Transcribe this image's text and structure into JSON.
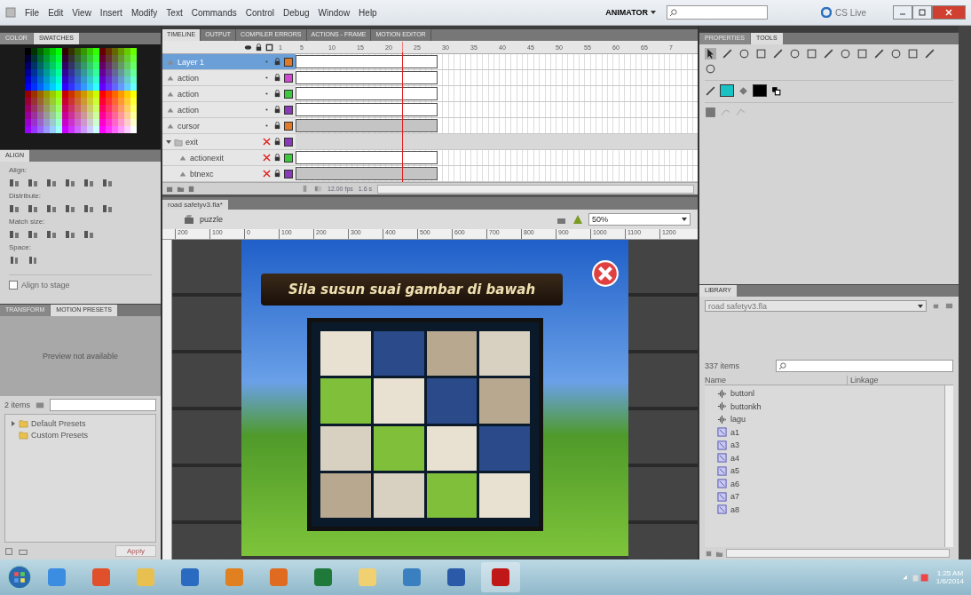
{
  "menu_bar": {
    "items": [
      "File",
      "Edit",
      "View",
      "Insert",
      "Modify",
      "Text",
      "Commands",
      "Control",
      "Debug",
      "Window",
      "Help"
    ],
    "workspace": "ANIMATOR",
    "cs_live": "CS Live"
  },
  "color_panel": {
    "tabs": [
      {
        "label": "COLOR",
        "selected": false
      },
      {
        "label": "SWATCHES",
        "selected": true
      }
    ]
  },
  "align_panel": {
    "title": "ALIGN",
    "sections": [
      "Align:",
      "Distribute:",
      "Match size:",
      "Space:"
    ],
    "align_to_stage": {
      "label": "Align to stage",
      "checked": false
    }
  },
  "presets_panel": {
    "tabs": [
      {
        "label": "TRANSFORM",
        "selected": false
      },
      {
        "label": "MOTION PRESETS",
        "selected": true
      }
    ],
    "preview": "Preview not available",
    "count": "2 items",
    "tree": [
      {
        "label": "Default Presets",
        "expanded": false
      },
      {
        "label": "Custom Presets"
      }
    ],
    "apply": "Apply"
  },
  "timeline": {
    "tabs": [
      {
        "label": "TIMELINE",
        "selected": true
      },
      {
        "label": "OUTPUT",
        "selected": false
      },
      {
        "label": "COMPILER ERRORS",
        "selected": false
      },
      {
        "label": "ACTIONS - FRAME",
        "selected": false
      },
      {
        "label": "MOTION EDITOR",
        "selected": false
      }
    ],
    "frame_numbers": [
      "1",
      "5",
      "10",
      "15",
      "20",
      "25",
      "30",
      "35",
      "40",
      "45",
      "50",
      "55",
      "60",
      "65",
      "7"
    ],
    "layers": [
      {
        "name": "Layer 1",
        "kind": "layer",
        "selected": true,
        "hidden": false,
        "shaded": false,
        "color": "#e07a2a"
      },
      {
        "name": "action",
        "kind": "layer",
        "selected": false,
        "hidden": false,
        "shaded": false,
        "color": "#d04ad0"
      },
      {
        "name": "action",
        "kind": "layer",
        "selected": false,
        "hidden": false,
        "shaded": false,
        "color": "#3ec83e"
      },
      {
        "name": "action",
        "kind": "layer",
        "selected": false,
        "hidden": false,
        "shaded": false,
        "color": "#8a3ab8"
      },
      {
        "name": "cursor",
        "kind": "layer",
        "selected": false,
        "hidden": false,
        "shaded": true,
        "color": "#e07a2a"
      },
      {
        "name": "exit",
        "kind": "folder",
        "selected": false,
        "hidden": true,
        "color": "#8a3ab8",
        "expanded": true,
        "children": [
          {
            "name": "actionexit",
            "kind": "layer",
            "selected": false,
            "hidden": true,
            "shaded": false,
            "color": "#3ec83e"
          },
          {
            "name": "btnexc",
            "kind": "layer",
            "selected": false,
            "hidden": true,
            "shaded": true,
            "color": "#8a3ab8"
          }
        ]
      }
    ],
    "fps": "12.00 fps",
    "time": "1.6 s"
  },
  "document": {
    "tab": "road safetyv3.fla*",
    "scene": "puzzle",
    "zoom": "50%",
    "ruler": [
      "200",
      "100",
      "0",
      "100",
      "200",
      "300",
      "400",
      "500",
      "600",
      "700",
      "800",
      "900",
      "1000",
      "1100",
      "1200"
    ]
  },
  "stage": {
    "banner": "Sila susun suai gambar di bawah"
  },
  "tools_panel": {
    "tabs": [
      {
        "label": "PROPERTIES",
        "selected": false
      },
      {
        "label": "TOOLS",
        "selected": true
      }
    ]
  },
  "library": {
    "title": "LIBRARY",
    "file": "road safetyv3.fla",
    "count": "337 items",
    "columns": [
      "Name",
      "Linkage"
    ],
    "items": [
      {
        "name": "buttonl",
        "kind": "sound"
      },
      {
        "name": "buttonkh",
        "kind": "sound"
      },
      {
        "name": "lagu",
        "kind": "sound"
      },
      {
        "name": "a1",
        "kind": "symbol"
      },
      {
        "name": "a3",
        "kind": "symbol"
      },
      {
        "name": "a4",
        "kind": "symbol"
      },
      {
        "name": "a5",
        "kind": "symbol"
      },
      {
        "name": "a6",
        "kind": "symbol"
      },
      {
        "name": "a7",
        "kind": "symbol"
      },
      {
        "name": "a8",
        "kind": "symbol"
      }
    ]
  },
  "taskbar": {
    "time": "1:25 AM",
    "date": "1/6/2014"
  }
}
